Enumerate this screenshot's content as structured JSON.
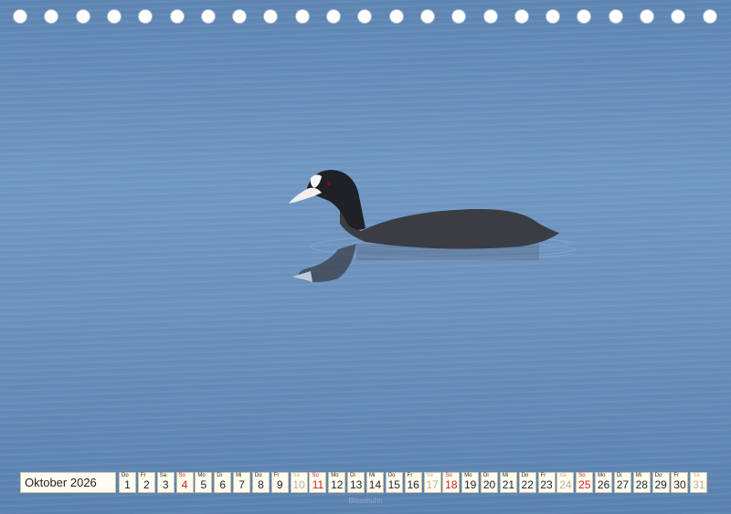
{
  "calendar": {
    "month_label": "Oktober 2026",
    "days": [
      {
        "wd": "Do",
        "num": "1",
        "kind": "weekday"
      },
      {
        "wd": "Fr",
        "num": "2",
        "kind": "weekday"
      },
      {
        "wd": "Sa",
        "num": "3",
        "kind": "holiday"
      },
      {
        "wd": "So",
        "num": "4",
        "kind": "sun"
      },
      {
        "wd": "Mo",
        "num": "5",
        "kind": "weekday"
      },
      {
        "wd": "Di",
        "num": "6",
        "kind": "weekday"
      },
      {
        "wd": "Mi",
        "num": "7",
        "kind": "weekday"
      },
      {
        "wd": "Do",
        "num": "8",
        "kind": "weekday"
      },
      {
        "wd": "Fr",
        "num": "9",
        "kind": "weekday"
      },
      {
        "wd": "Sa",
        "num": "10",
        "kind": "sat"
      },
      {
        "wd": "So",
        "num": "11",
        "kind": "sun"
      },
      {
        "wd": "Mo",
        "num": "12",
        "kind": "weekday"
      },
      {
        "wd": "Di",
        "num": "13",
        "kind": "weekday"
      },
      {
        "wd": "Mi",
        "num": "14",
        "kind": "weekday"
      },
      {
        "wd": "Do",
        "num": "15",
        "kind": "weekday"
      },
      {
        "wd": "Fr",
        "num": "16",
        "kind": "weekday"
      },
      {
        "wd": "Sa",
        "num": "17",
        "kind": "sat"
      },
      {
        "wd": "So",
        "num": "18",
        "kind": "sun"
      },
      {
        "wd": "Mo",
        "num": "19",
        "kind": "weekday"
      },
      {
        "wd": "Di",
        "num": "20",
        "kind": "weekday"
      },
      {
        "wd": "Mi",
        "num": "21",
        "kind": "weekday"
      },
      {
        "wd": "Do",
        "num": "22",
        "kind": "weekday"
      },
      {
        "wd": "Fr",
        "num": "23",
        "kind": "weekday"
      },
      {
        "wd": "Sa",
        "num": "24",
        "kind": "sat"
      },
      {
        "wd": "So",
        "num": "25",
        "kind": "sun"
      },
      {
        "wd": "Mo",
        "num": "26",
        "kind": "weekday"
      },
      {
        "wd": "Di",
        "num": "27",
        "kind": "weekday"
      },
      {
        "wd": "Mi",
        "num": "28",
        "kind": "weekday"
      },
      {
        "wd": "Do",
        "num": "29",
        "kind": "weekday"
      },
      {
        "wd": "Fr",
        "num": "30",
        "kind": "weekday"
      },
      {
        "wd": "Sa",
        "num": "31",
        "kind": "sat"
      }
    ]
  },
  "caption": "Blässhuhn",
  "binding_holes": 23,
  "colors": {
    "water": "#6c93bf",
    "cell_bg": "#fffdf1",
    "sunday_red": "#d21a1a",
    "saturday_grey": "#b7b29e"
  }
}
